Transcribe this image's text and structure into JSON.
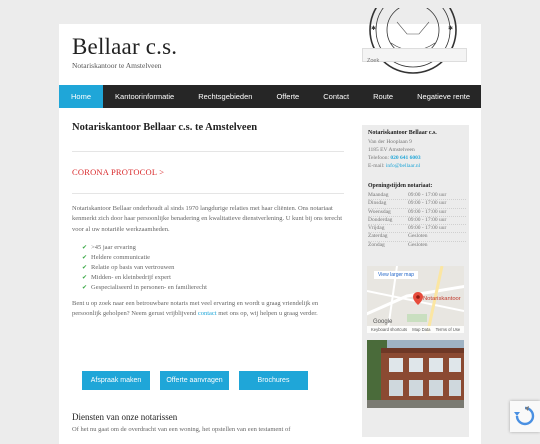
{
  "header": {
    "title": "Bellaar c.s.",
    "tagline": "Notariskantoor te Amstelveen",
    "search_placeholder": "Zoek"
  },
  "nav": {
    "items": [
      {
        "label": "Home",
        "active": true
      },
      {
        "label": "Kantoorinformatie",
        "active": false
      },
      {
        "label": "Rechtsgebieden",
        "active": false
      },
      {
        "label": "Offerte",
        "active": false
      },
      {
        "label": "Contact",
        "active": false
      },
      {
        "label": "Route",
        "active": false
      },
      {
        "label": "Negatieve rente",
        "active": false
      }
    ]
  },
  "main": {
    "heading": "Notariskantoor Bellaar c.s. te Amstelveen",
    "corona": "CORONA PROTOCOL >",
    "intro": "Notariskantoor Bellaar onderhoudt al sinds 1970 langdurige relaties met haar cliënten. Ons notariaat kenmerkt zich door haar persoonlijke benadering en kwalitatieve dienstverlening. U kunt bij ons terecht voor al uw notariële werkzaamheden.",
    "checklist": [
      ">45 jaar ervaring",
      "Heldere communicatie",
      "Relatie op basis van vertrouwen",
      "Midden- en kleinbedrijf expert",
      "Gespecialiseerd in personen- en familierecht"
    ],
    "para2_before": "Bent u op zoek naar een betrouwbare notaris met veel ervaring en wordt u graag vriendelijk en persoonlijk geholpen? Neem gerust vrijblijvend ",
    "para2_link": "contact",
    "para2_after": " met ons op, wij helpen u graag verder.",
    "buttons": [
      "Afspraak maken",
      "Offerte aanvragen",
      "Brochures"
    ],
    "subheading": "Diensten van onze notarissen",
    "cut_text": "Of het nu gaat om de overdracht van een woning, het opstellen van een testament of"
  },
  "sidebar": {
    "title": "Notariskantoor Bellaar c.s.",
    "address1": "Van der Hooplaan 9",
    "address2": "1185 EV Amstelveen",
    "phone_label": "Telefoon: ",
    "phone": "020 641 6003",
    "email_label": "E-mail: ",
    "email": "info@bellaar.nl",
    "hours_title": "Openingstijden notariaat:",
    "hours": [
      {
        "day": "Maandag",
        "time": "09:00 - 17:00 uur"
      },
      {
        "day": "Dinsdag",
        "time": "09:00 - 17:00 uur"
      },
      {
        "day": "Woensdag",
        "time": "09:00 - 17:00 uur"
      },
      {
        "day": "Donderdag",
        "time": "09:00 - 17:00 uur"
      },
      {
        "day": "Vrijdag",
        "time": "09:00 - 17:00 uur"
      },
      {
        "day": "Zaterdag",
        "time": "Gesloten"
      },
      {
        "day": "Zondag",
        "time": "Gesloten"
      }
    ],
    "map": {
      "button": "View larger map",
      "pin_label": "Notariskantoor",
      "logo": "Google",
      "footer": [
        "Keyboard shortcuts",
        "Map Data",
        "Terms of Use"
      ]
    }
  },
  "colors": {
    "accent": "#1fa6d8",
    "nav_bg": "#262626",
    "corona": "#d9292b",
    "check": "#39a845"
  }
}
